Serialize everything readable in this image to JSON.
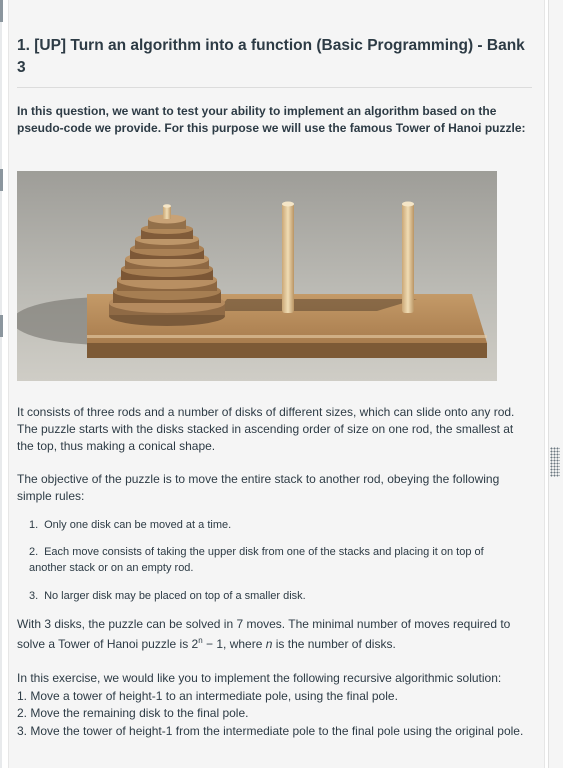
{
  "question": {
    "title": "1. [UP] Turn an algorithm into a function (Basic Programming) - Bank 3",
    "intro": "In this question, we want to test your ability to implement an algorithm based on the pseudo-code we provide. For this purpose we will use the famous Tower of Hanoi puzzle:",
    "image_alt": "Tower of Hanoi puzzle photo",
    "para1": "It consists of three rods and a number of disks of different sizes, which can slide onto any rod. The puzzle starts with the disks stacked in ascending order of size on one rod, the smallest at the top, thus making a conical shape.",
    "para2": "The objective of the puzzle is to move the entire stack to another rod, obeying the following simple rules:",
    "rules": [
      {
        "num": "1.",
        "text": "Only one disk can be moved at a time."
      },
      {
        "num": "2.",
        "text": "Each move consists of taking the upper disk from one of the stacks and placing it on top of another stack or on an empty rod."
      },
      {
        "num": "3.",
        "text": "No larger disk may be placed on top of a smaller disk."
      }
    ],
    "para3_a": "With 3 disks, the puzzle can be solved in 7 moves. The minimal number of moves required to solve a Tower of Hanoi puzzle is 2",
    "para3_sup": "n",
    "para3_b": " − 1, where ",
    "para3_var": "n",
    "para3_c": " is the number of disks.",
    "para4_intro": "In this exercise, we would like you to implement the following recursive algorithmic solution:",
    "steps": [
      "1. Move a tower of height-1 to an intermediate pole, using the final pole.",
      "2. Move the remaining disk to the final pole.",
      "3. Move the tower of height-1 from the intermediate pole to the final pole using the original pole."
    ]
  },
  "colors": {
    "panel_bg": "#f5f5f5",
    "text": "#2d3b45"
  }
}
